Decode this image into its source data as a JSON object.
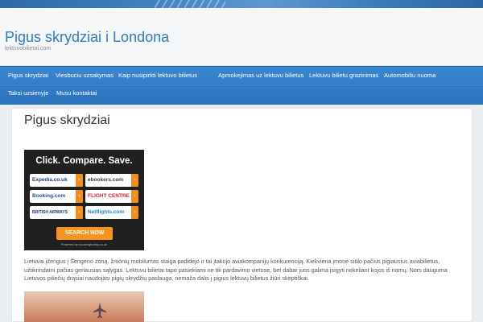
{
  "header": {
    "title": "Pigus skrydziai i Londona",
    "tagline": "lektuvobilietai.com"
  },
  "nav": {
    "items": [
      "Pigus skrydziai",
      "Viesbuciu uzsakymas",
      "Kaip nusipirkti lektuvo bilietus",
      "Apmokejimas uz lektuvu bilietus",
      "Lektuvu bilietu grazinimas",
      "Automobiliu nuoma",
      "Taksi uzsienyje",
      "Musu kontaktai"
    ]
  },
  "page": {
    "title": "Pigus skrydziai"
  },
  "ad": {
    "headline": "Click. Compare. Save.",
    "tiles": [
      "Expedia.co.uk",
      "ebookers.com",
      "Booking.com",
      "FLIGHT CENTRE",
      "BRITISH AIRWAYS",
      "Netflights.com"
    ],
    "tile_colors": [
      "#1b3f8f",
      "#3d3d3d",
      "#1f4fa3",
      "#d8262c",
      "#1a3b7a",
      "#1a8ad0"
    ],
    "search_label": "SEARCH NOW",
    "powered_by": "Powered by bookingbuddy.co.uk"
  },
  "body": {
    "lines": [
      "Lietuvai įžengus į Šengeno zoną, žmonių mobilumas staiga padidėjo ir tai įtakojo aviakompanijų konkurenciją. Kiekviena įmonė siūlo pačius pigiausius aviabilietus,",
      "užtikrindami pačias geriausias sąlygas. Lektuvu bilietai tapo pasiekiami ne tik pardavimo vietose, bet dabar juos galima įsigyti nekeliant kojos iš namų. Nors dauguma",
      "Lietuvos piliečių drąsiai naudojasi pigių skrydžių paslauga, nemaža dalis į pigius lektuvų bilietus žiūri skeptiškai."
    ]
  },
  "colors": {
    "accent": "#2f7cc3",
    "nav_bg": "#3080c8",
    "ad_orange": "#f7941d"
  }
}
